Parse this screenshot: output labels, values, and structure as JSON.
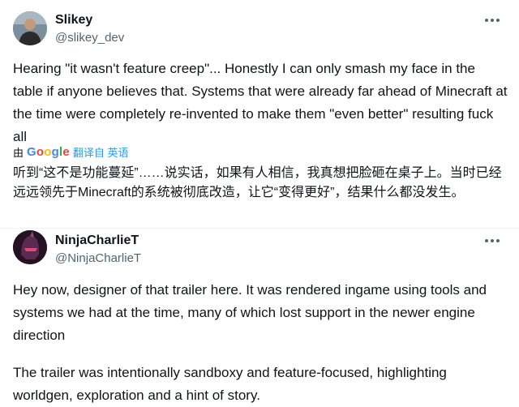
{
  "posts": [
    {
      "author_name": "Slikey",
      "author_handle": "@slikey_dev",
      "avatar_icon": "person-avatar-icon",
      "text": "Hearing \"it wasn't feature creep\"... Honestly I can only smash my face in the table if anyone believes that. Systems that were already far ahead of Minecraft at the time were completely re-invented to make them \"even better\" resulting fuck all",
      "translate_prefix": "由",
      "translate_brand": "Google",
      "translate_action": "翻译自 英语",
      "translation": "听到“这不是功能蔓延”……说实话，如果有人相信，我真想把脸砸在桌子上。当时已经远远领先于Minecraft的系统被彻底改造，让它“变得更好”，结果什么都没发生。"
    },
    {
      "author_name": "NinjaCharlieT",
      "author_handle": "@NinjaCharlieT",
      "avatar_icon": "helmet-avatar-icon",
      "text_p1": "Hey now, designer of that trailer here. It was rendered ingame using tools and systems we had at the time, many of which lost support in the newer engine direction",
      "text_p2": "The trailer was intentionally sandboxy and feature-focused, highlighting worldgen, exploration and a hint of story."
    }
  ],
  "colors": {
    "text": "#0f1419",
    "secondary": "#536471",
    "link": "#1d9bf0"
  }
}
